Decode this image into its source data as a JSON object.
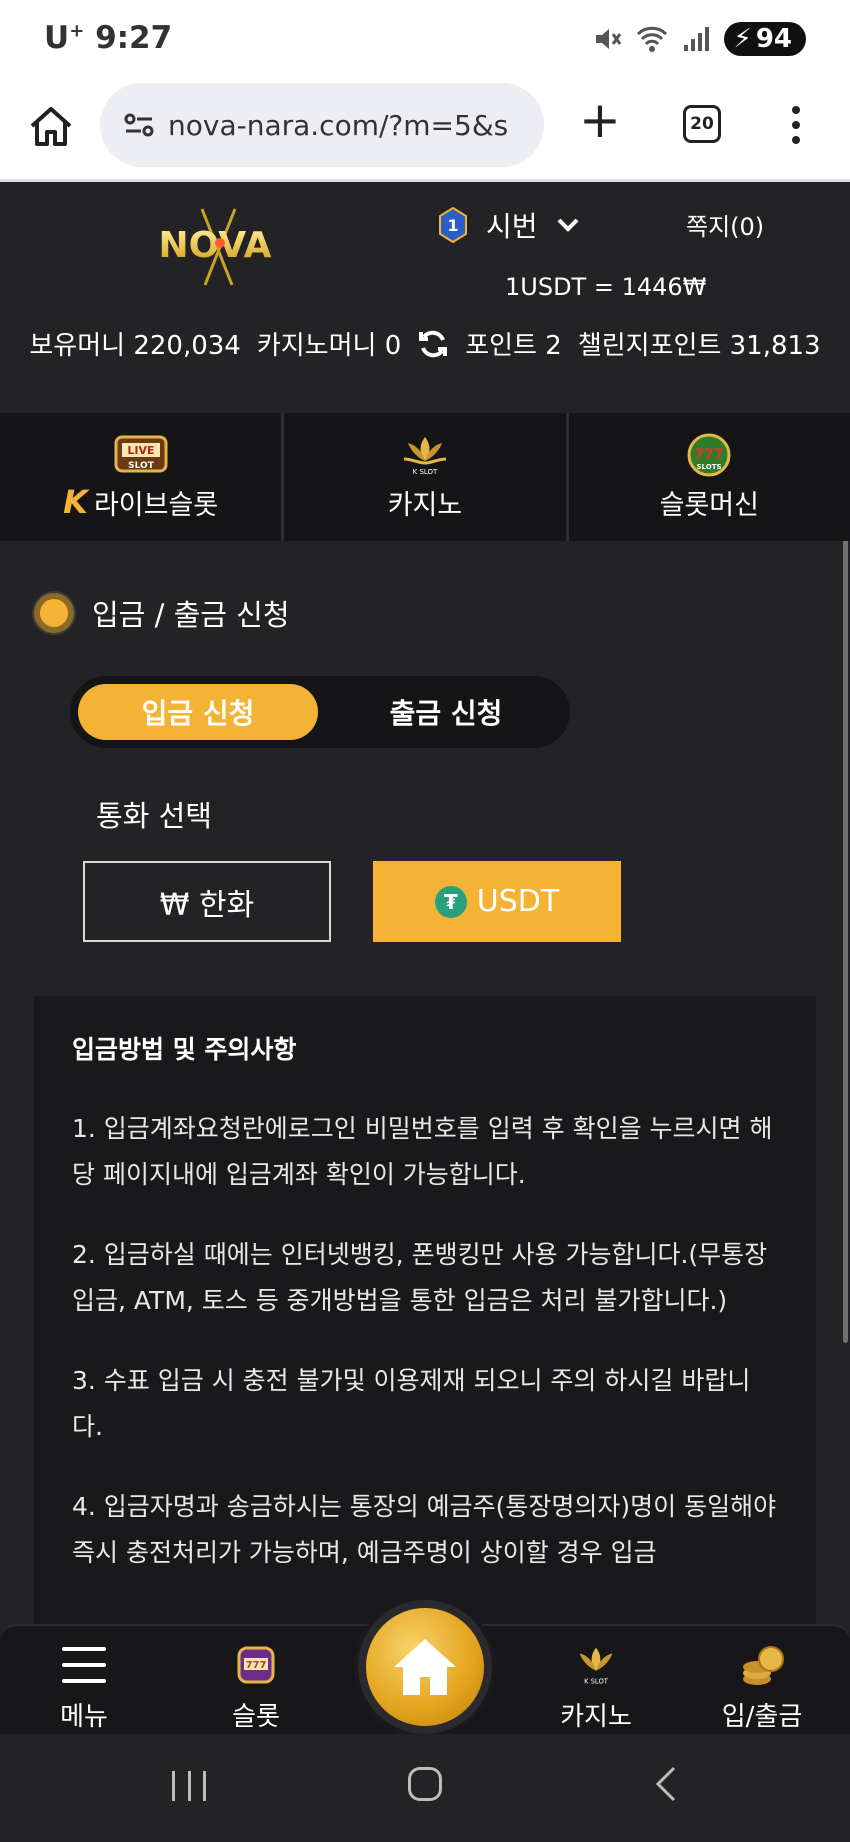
{
  "status_bar": {
    "carrier": "U",
    "carrier_sup": "+",
    "time": "9:27",
    "battery": "94"
  },
  "browser": {
    "url": "nova-nara.com/?m=5&s",
    "tab_count": "20"
  },
  "header": {
    "logo_text": "NOVA",
    "level": "1",
    "username": "시번",
    "notes": "쪽지(0)",
    "rate": "1USDT = 1446₩",
    "balances": {
      "money": "보유머니 220,034",
      "casino_money": "카지노머니 0",
      "points": "포인트 2",
      "challenge_points": "챌린지포인트 31,813"
    }
  },
  "categories": [
    {
      "label": "라이브슬롯",
      "icon": "live-slot-icon",
      "prefix": "K"
    },
    {
      "label": "카지노",
      "icon": "k-slot-lotus-icon"
    },
    {
      "label": "슬롯머신",
      "icon": "777-slots-icon"
    }
  ],
  "section": {
    "title": "입금 / 출금 신청",
    "tabs": {
      "deposit": "입금 신청",
      "withdraw": "출금 신청"
    },
    "currency_label": "통화 선택",
    "currency_options": {
      "krw": "₩ 한화",
      "usdt": "USDT"
    }
  },
  "notice": {
    "title": "입금방법 및 주의사항",
    "items": [
      "1. 입금계좌요청란에로그인 비밀번호를 입력 후 확인을 누르시면 해당 페이지내에 입금계좌 확인이 가능합니다.",
      "2. 입금하실 때에는 인터넷뱅킹, 폰뱅킹만 사용 가능합니다.(무통장입금, ATM, 토스 등 중개방법을 통한 입금은 처리 불가합니다.)",
      "3. 수표 입금 시 충전 불가및 이용제재 되오니 주의 하시길 바랍니다.",
      "4. 입금자명과 송금하시는 통장의 예금주(통장명의자)명이 동일해야 즉시 충전처리가 가능하며, 예금주명이 상이할 경우 입금"
    ]
  },
  "bottom_nav": {
    "menu": "메뉴",
    "slot": "슬롯",
    "casino": "카지노",
    "deposit": "입/출금"
  },
  "colors": {
    "accent": "#f4b334",
    "background": "#232326",
    "panel": "#19191c"
  }
}
